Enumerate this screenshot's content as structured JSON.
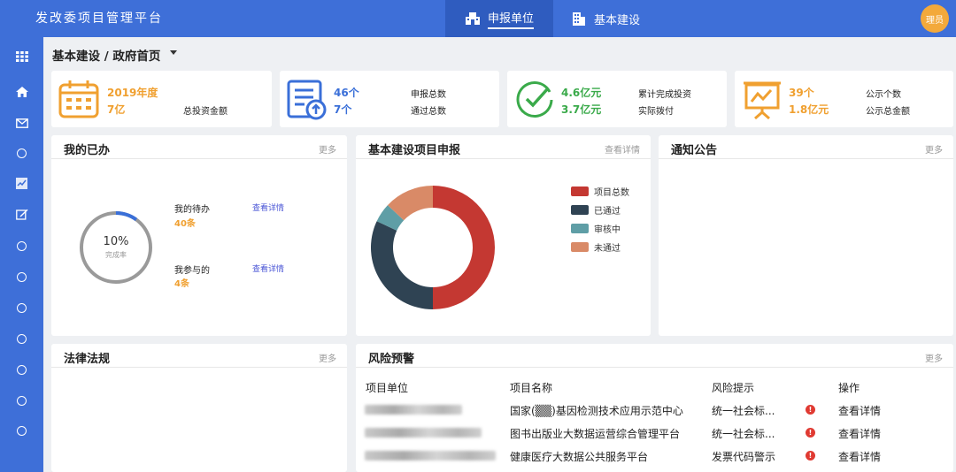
{
  "app": {
    "brand": "发改委项目管理平台",
    "tabs": [
      {
        "label": "申报单位"
      },
      {
        "label": "基本建设"
      }
    ],
    "avatar": "理员"
  },
  "breadcrumb": "基本建设 / 政府首页",
  "stats": [
    {
      "value1": "2019年度",
      "value2": "7亿",
      "label1": "",
      "label2": "总投资金额",
      "color": "#f0a030",
      "icon": "calendar-icon"
    },
    {
      "value1": "46个",
      "value2": "7个",
      "label1": "申报总数",
      "label2": "通过总数",
      "color": "#3a6fd8",
      "icon": "document-upload-icon"
    },
    {
      "value1": "4.6亿元",
      "value2": "3.7亿元",
      "label1": "累计完成投资",
      "label2": "实际拨付",
      "color": "#3aaa4a",
      "icon": "check-circle-icon"
    },
    {
      "value1": "39个",
      "value2": "1.8亿元",
      "label1": "公示个数",
      "label2": "公示总金额",
      "color": "#f0a030",
      "icon": "presentation-chart-icon"
    }
  ],
  "done": {
    "title": "我的已办",
    "more": "更多",
    "percent": "10%",
    "percent_value": 0.1,
    "percent_label": "完成率",
    "items": [
      {
        "label": "我的待办",
        "count": "40条",
        "link": "查看详情"
      },
      {
        "label": "我参与的",
        "count": "4条",
        "link": "查看详情"
      }
    ]
  },
  "project": {
    "title": "基本建设项目申报",
    "more": "查看详情"
  },
  "chart_data": {
    "type": "pie",
    "labels": [
      "项目总数",
      "已通过",
      "审核中",
      "未通过"
    ],
    "values": [
      50,
      32,
      5,
      13
    ],
    "colors": [
      "#c43832",
      "#2f4353",
      "#5f9ea6",
      "#d98a67"
    ]
  },
  "notice": {
    "title": "通知公告",
    "more": "更多"
  },
  "law": {
    "title": "法律法规",
    "more": "更多"
  },
  "risk": {
    "title": "风险预警",
    "more": "更多",
    "columns": [
      "项目单位",
      "项目名称",
      "风险提示",
      "操作"
    ],
    "rows": [
      {
        "name": "国家(▒▒)基因检测技术应用示范中心",
        "hint": "统一社会标...",
        "action": "查看详情"
      },
      {
        "name": "图书出版业大数据运营综合管理平台",
        "hint": "统一社会标...",
        "action": "查看详情"
      },
      {
        "name": "健康医疗大数据公共服务平台",
        "hint": "发票代码警示",
        "action": "查看详情"
      }
    ],
    "warn_symbol": "!"
  }
}
